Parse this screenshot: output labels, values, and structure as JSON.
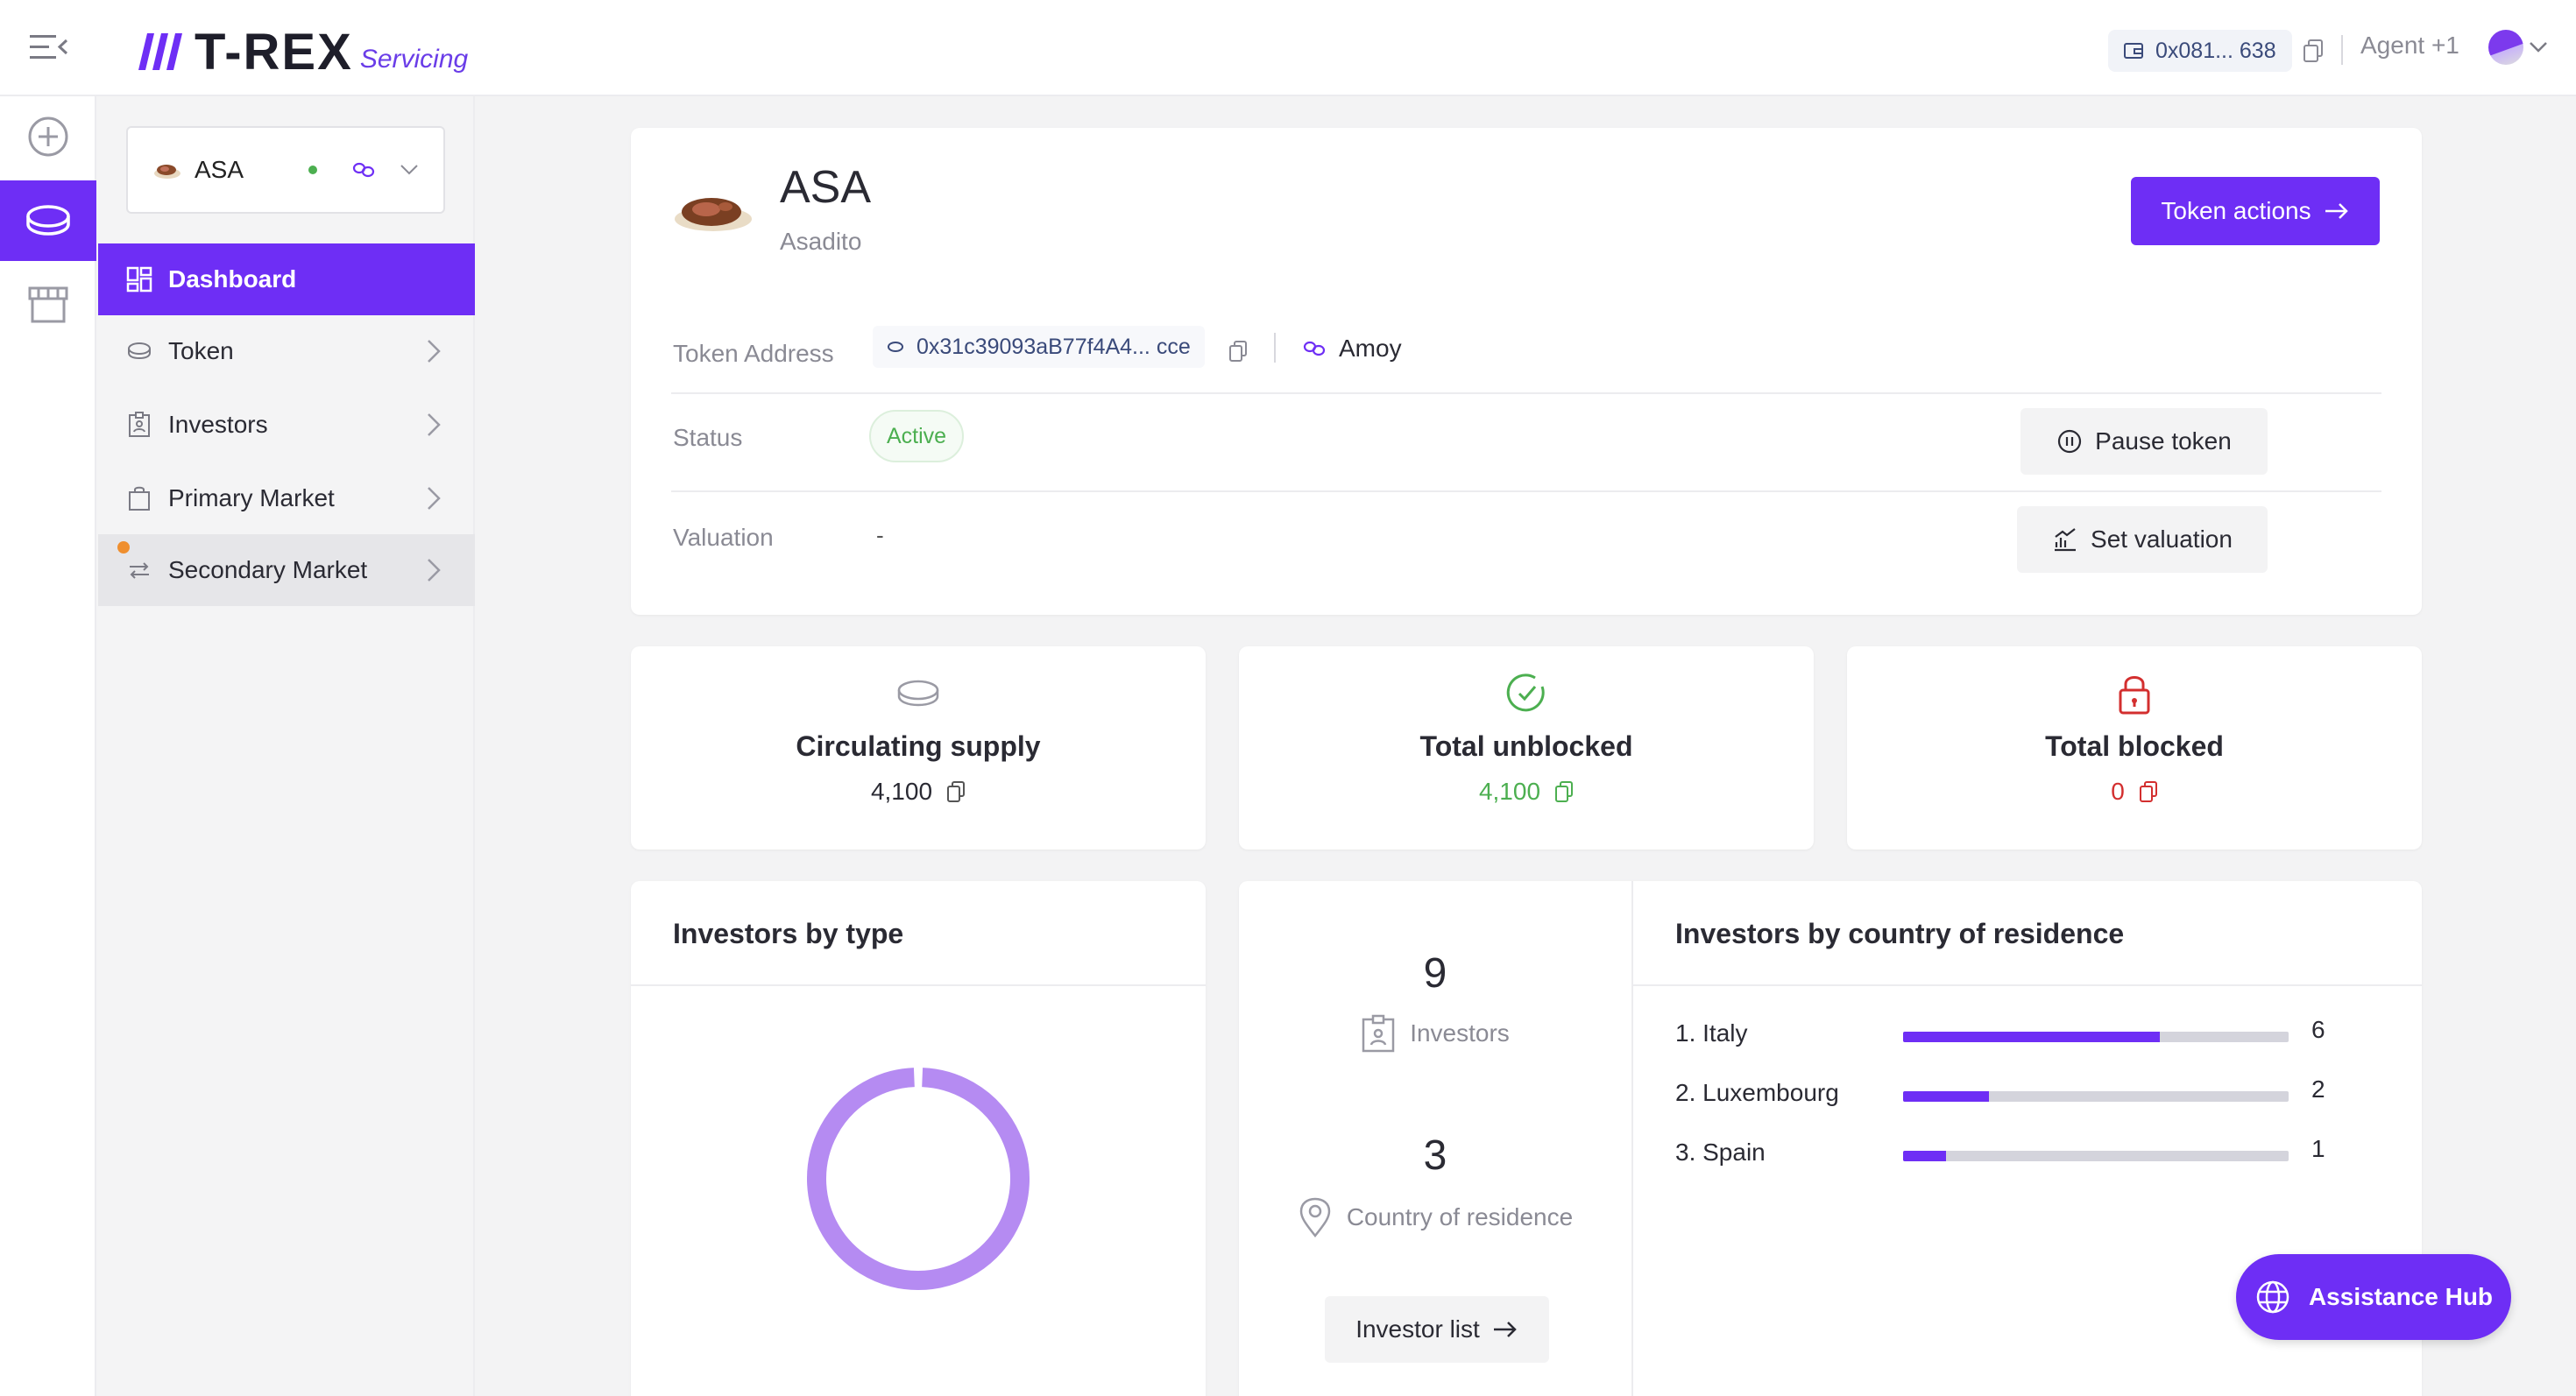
{
  "app": {
    "logo_text": "T-REX",
    "logo_sub": "Servicing",
    "wallet_address": "0x081... 638",
    "agent_label": "Agent +1"
  },
  "sidebar": {
    "token_selector": {
      "symbol": "ASA"
    },
    "items": [
      {
        "label": "Dashboard",
        "icon": "dashboard-icon",
        "active": true
      },
      {
        "label": "Token",
        "icon": "coin-icon"
      },
      {
        "label": "Investors",
        "icon": "id-badge-icon"
      },
      {
        "label": "Primary Market",
        "icon": "shopping-bag-icon"
      },
      {
        "label": "Secondary Market",
        "icon": "swap-arrows-icon",
        "has_notification": true
      }
    ]
  },
  "token": {
    "symbol": "ASA",
    "name": "Asadito",
    "actions_label": "Token actions",
    "address_label": "Token Address",
    "address": "0x31c39093aB77f4A4... cce",
    "network": "Amoy",
    "status_label": "Status",
    "status": "Active",
    "pause_label": "Pause token",
    "valuation_label": "Valuation",
    "valuation": "-",
    "set_valuation_label": "Set valuation"
  },
  "stats": {
    "circulating": {
      "title": "Circulating supply",
      "value": "4,100"
    },
    "unblocked": {
      "title": "Total unblocked",
      "value": "4,100"
    },
    "blocked": {
      "title": "Total blocked",
      "value": "0"
    }
  },
  "investors_by_type": {
    "title": "Investors by type"
  },
  "counts": {
    "investors_num": "9",
    "investors_label": "Investors",
    "countries_num": "3",
    "countries_label": "Country of residence",
    "list_button": "Investor list"
  },
  "by_country": {
    "title": "Investors by country of residence",
    "rows": [
      {
        "name": "1. Italy",
        "count": "6"
      },
      {
        "name": "2. Luxembourg",
        "count": "2"
      },
      {
        "name": "3. Spain",
        "count": "1"
      }
    ]
  },
  "assistance": {
    "label": "Assistance Hub"
  },
  "colors": {
    "accent": "#6e2ef5",
    "success": "#4caf50",
    "danger": "#d32f2f",
    "donut": "#b58bf2"
  },
  "chart_data": [
    {
      "type": "pie",
      "title": "Investors by type",
      "values": [
        9
      ],
      "categories": [
        ""
      ]
    },
    {
      "type": "bar",
      "title": "Investors by country of residence",
      "categories": [
        "Italy",
        "Luxembourg",
        "Spain"
      ],
      "values": [
        6,
        2,
        1
      ]
    }
  ]
}
